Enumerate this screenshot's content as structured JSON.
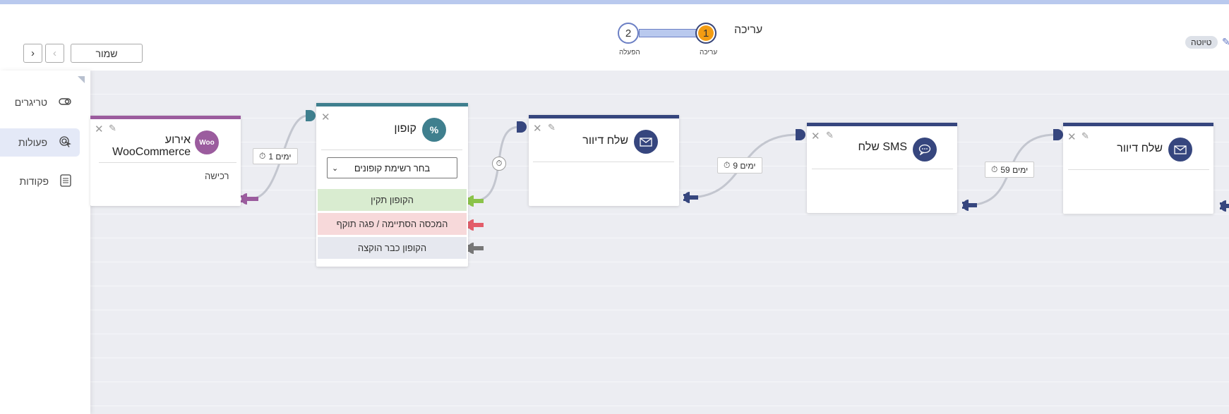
{
  "header": {
    "title": "עריכה",
    "save_label": "שמור",
    "draft_badge": "טיוטה",
    "steps": [
      {
        "number": "1",
        "label": "עריכה"
      },
      {
        "number": "2",
        "label": "הפעלה"
      }
    ]
  },
  "sidebar": {
    "items": [
      {
        "label": "טריגרים",
        "icon": "toggle-icon"
      },
      {
        "label": "פעולות",
        "icon": "cursor-click-icon"
      },
      {
        "label": "פקודות",
        "icon": "checklist-icon"
      }
    ]
  },
  "nodes": {
    "woo": {
      "title": "אירוע WooCommerce",
      "subtitle": "רכישה",
      "icon_text": "Woo",
      "color": "#9b5c9e"
    },
    "coupon": {
      "title": "קופון",
      "icon_text": "%",
      "color": "#3f7f8e",
      "select_value": "בחר רשימת קופונים",
      "outcomes": [
        "הקופון תקין",
        "המכסה הסתיימה / פגה תוקף",
        "הקופון כבר הוקצה"
      ]
    },
    "mail1": {
      "title": "שלח דיוור",
      "color": "#36467e"
    },
    "sms": {
      "title": "שלח SMS",
      "color": "#36467e"
    },
    "mail2": {
      "title": "שלח דיוור",
      "color": "#36467e"
    }
  },
  "delays": [
    "1 ימים",
    "9 ימים",
    "59 ימים"
  ],
  "colors": {
    "accent": "#f39c12",
    "valid": "#d9ecd0",
    "expired": "#f7d9da",
    "used": "#e6e8ef"
  }
}
